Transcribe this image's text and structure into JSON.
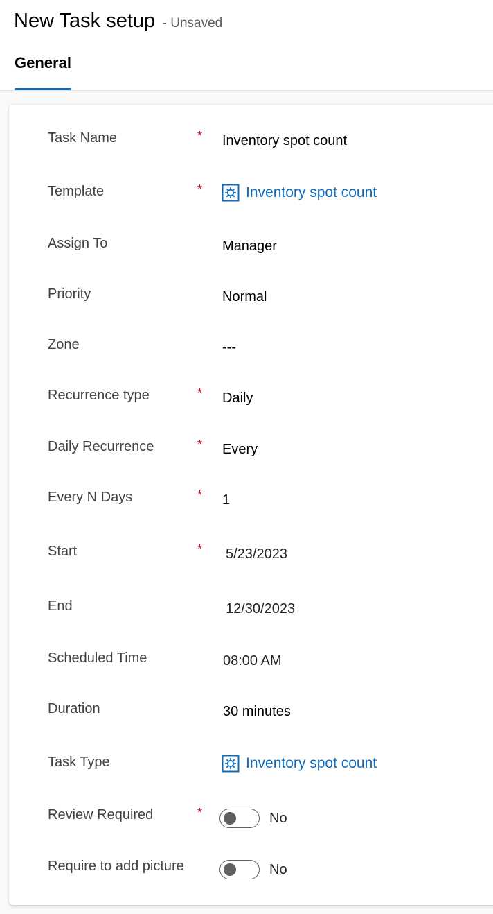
{
  "header": {
    "title": "New Task setup",
    "status": "- Unsaved",
    "tabs": [
      {
        "label": "General",
        "active": true
      }
    ]
  },
  "form": {
    "fields": {
      "task_name": {
        "label": "Task Name",
        "required": true,
        "value": "Inventory spot count"
      },
      "template": {
        "label": "Template",
        "required": true,
        "value": "Inventory spot count",
        "icon": "entity-record-icon"
      },
      "assign_to": {
        "label": "Assign To",
        "required": false,
        "value": "Manager"
      },
      "priority": {
        "label": "Priority",
        "required": false,
        "value": "Normal"
      },
      "zone": {
        "label": "Zone",
        "required": false,
        "value": "---"
      },
      "recurrence_type": {
        "label": "Recurrence type",
        "required": true,
        "value": "Daily"
      },
      "daily_recurrence": {
        "label": "Daily Recurrence",
        "required": true,
        "value": "Every"
      },
      "every_n_days": {
        "label": "Every N Days",
        "required": true,
        "value": "1"
      },
      "start": {
        "label": "Start",
        "required": true,
        "value": "5/23/2023"
      },
      "end": {
        "label": "End",
        "required": false,
        "value": "12/30/2023"
      },
      "scheduled_time": {
        "label": "Scheduled Time",
        "required": false,
        "value": "08:00 AM"
      },
      "duration": {
        "label": "Duration",
        "required": false,
        "value": "30 minutes"
      },
      "task_type": {
        "label": "Task Type",
        "required": false,
        "value": "Inventory spot count",
        "icon": "entity-record-icon"
      },
      "review_required": {
        "label": "Review Required",
        "required": true,
        "value": "No",
        "on": false
      },
      "require_picture": {
        "label": "Require to add picture",
        "required": false,
        "value": "No",
        "on": false
      }
    },
    "required_marker": "*"
  },
  "colors": {
    "accent": "#0f6cbd",
    "required": "#c50f1f",
    "background": "#faf9f8"
  }
}
